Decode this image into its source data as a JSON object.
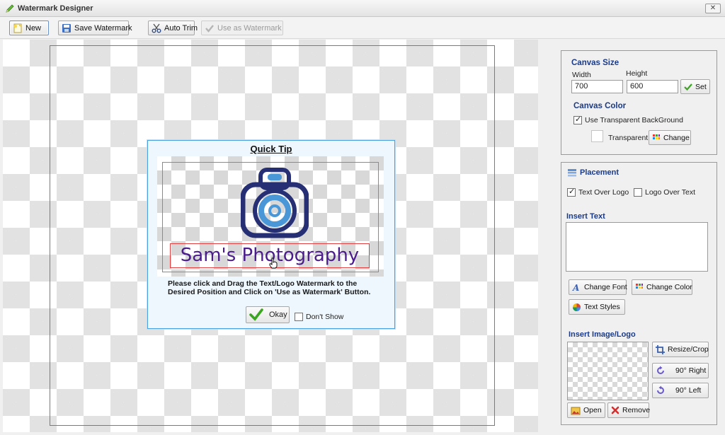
{
  "window": {
    "title": "Watermark Designer",
    "close_label": "✕"
  },
  "toolbar": {
    "new_label": "New",
    "save_label": "Save Watermark",
    "autotrim_label": "Auto Trim",
    "use_label": "Use as Watermark"
  },
  "quick_tip": {
    "title": "Quick Tip",
    "sample_text": "Sam's Photography",
    "message": "Please click and Drag the Text/Logo Watermark to the Desired Position and Click on 'Use as Watermark' Button.",
    "okay_label": "Okay",
    "dont_show_label": "Don't Show",
    "dont_show_checked": false
  },
  "canvas_size": {
    "title": "Canvas Size",
    "width_label": "Width",
    "height_label": "Height",
    "width_value": "700",
    "height_value": "600",
    "set_label": "Set"
  },
  "canvas_color": {
    "title": "Canvas Color",
    "transparent_bg_label": "Use Transparent BackGround",
    "transparent_bg_checked": true,
    "color_name": "Transparent",
    "change_label": "Change"
  },
  "placement": {
    "title": "Placement",
    "text_over_logo_label": "Text Over Logo",
    "text_over_logo_checked": true,
    "logo_over_text_label": "Logo Over Text",
    "logo_over_text_checked": false
  },
  "insert_text": {
    "title": "Insert Text",
    "value": "",
    "change_font_label": "Change Font",
    "change_color_label": "Change Color",
    "text_styles_label": "Text Styles"
  },
  "insert_image": {
    "title": "Insert Image/Logo",
    "resize_crop_label": "Resize/Crop",
    "rotate_right_label": "90° Right",
    "rotate_left_label": "90° Left",
    "open_label": "Open",
    "remove_label": "Remove"
  },
  "colors": {
    "section_title": "#1a3a8a",
    "tip_border": "#4aa2e0",
    "watermark_text": "#4b1d8c",
    "camera_dark": "#262f74",
    "camera_light": "#4a97d8"
  }
}
